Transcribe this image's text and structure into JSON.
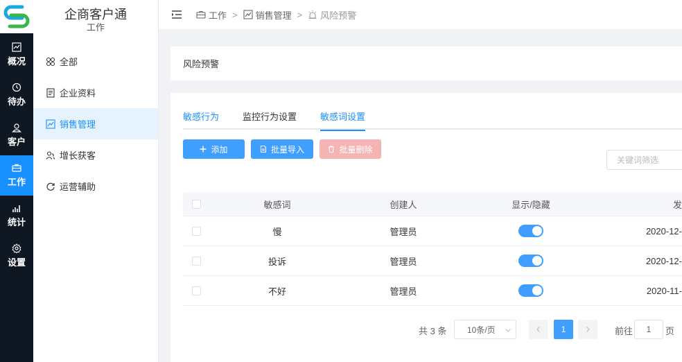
{
  "rail": {
    "items": [
      {
        "label": "概况",
        "icon": "chart-line-icon"
      },
      {
        "label": "待办",
        "icon": "clock-icon"
      },
      {
        "label": "客户",
        "icon": "user-icon"
      },
      {
        "label": "工作",
        "icon": "briefcase-icon",
        "active": true
      },
      {
        "label": "统计",
        "icon": "bar-chart-icon"
      },
      {
        "label": "设置",
        "icon": "gear-icon"
      }
    ]
  },
  "sidebar": {
    "title": "企商客户通",
    "subtitle": "工作",
    "items": [
      {
        "label": "全部",
        "icon": "grid-icon"
      },
      {
        "label": "企业资料",
        "icon": "document-icon"
      },
      {
        "label": "销售管理",
        "icon": "chart-icon",
        "active": true
      },
      {
        "label": "增长获客",
        "icon": "users-icon"
      },
      {
        "label": "运营辅助",
        "icon": "refresh-icon"
      }
    ]
  },
  "breadcrumb": {
    "items": [
      "工作",
      "销售管理",
      "风险预警"
    ],
    "separator": ">"
  },
  "page": {
    "title": "风险预警"
  },
  "tabs": [
    {
      "label": "敏感行为"
    },
    {
      "label": "监控行为设置"
    },
    {
      "label": "敏感词设置",
      "active": true
    }
  ],
  "toolbar": {
    "add_label": "添加",
    "import_label": "批量导入",
    "delete_label": "批量删除"
  },
  "search": {
    "placeholder": "关键词筛选",
    "value": ""
  },
  "table": {
    "headers": {
      "word": "敏感词",
      "creator": "创建人",
      "show": "显示/隐藏",
      "date": "发"
    },
    "rows": [
      {
        "word": "慢",
        "creator": "管理员",
        "shown": true,
        "date": "2020-12-"
      },
      {
        "word": "投诉",
        "creator": "管理员",
        "shown": true,
        "date": "2020-12-"
      },
      {
        "word": "不好",
        "creator": "管理员",
        "shown": true,
        "date": "2020-11-"
      }
    ]
  },
  "pagination": {
    "total": "共 3 条",
    "page_size": "10条/页",
    "current_page": "1",
    "goto_label": "前往",
    "goto_value": "1",
    "page_suffix": "页"
  },
  "colors": {
    "accent": "#1890ff",
    "danger_disabled": "#f4b4b4",
    "rail_bg": "#0f1722"
  }
}
